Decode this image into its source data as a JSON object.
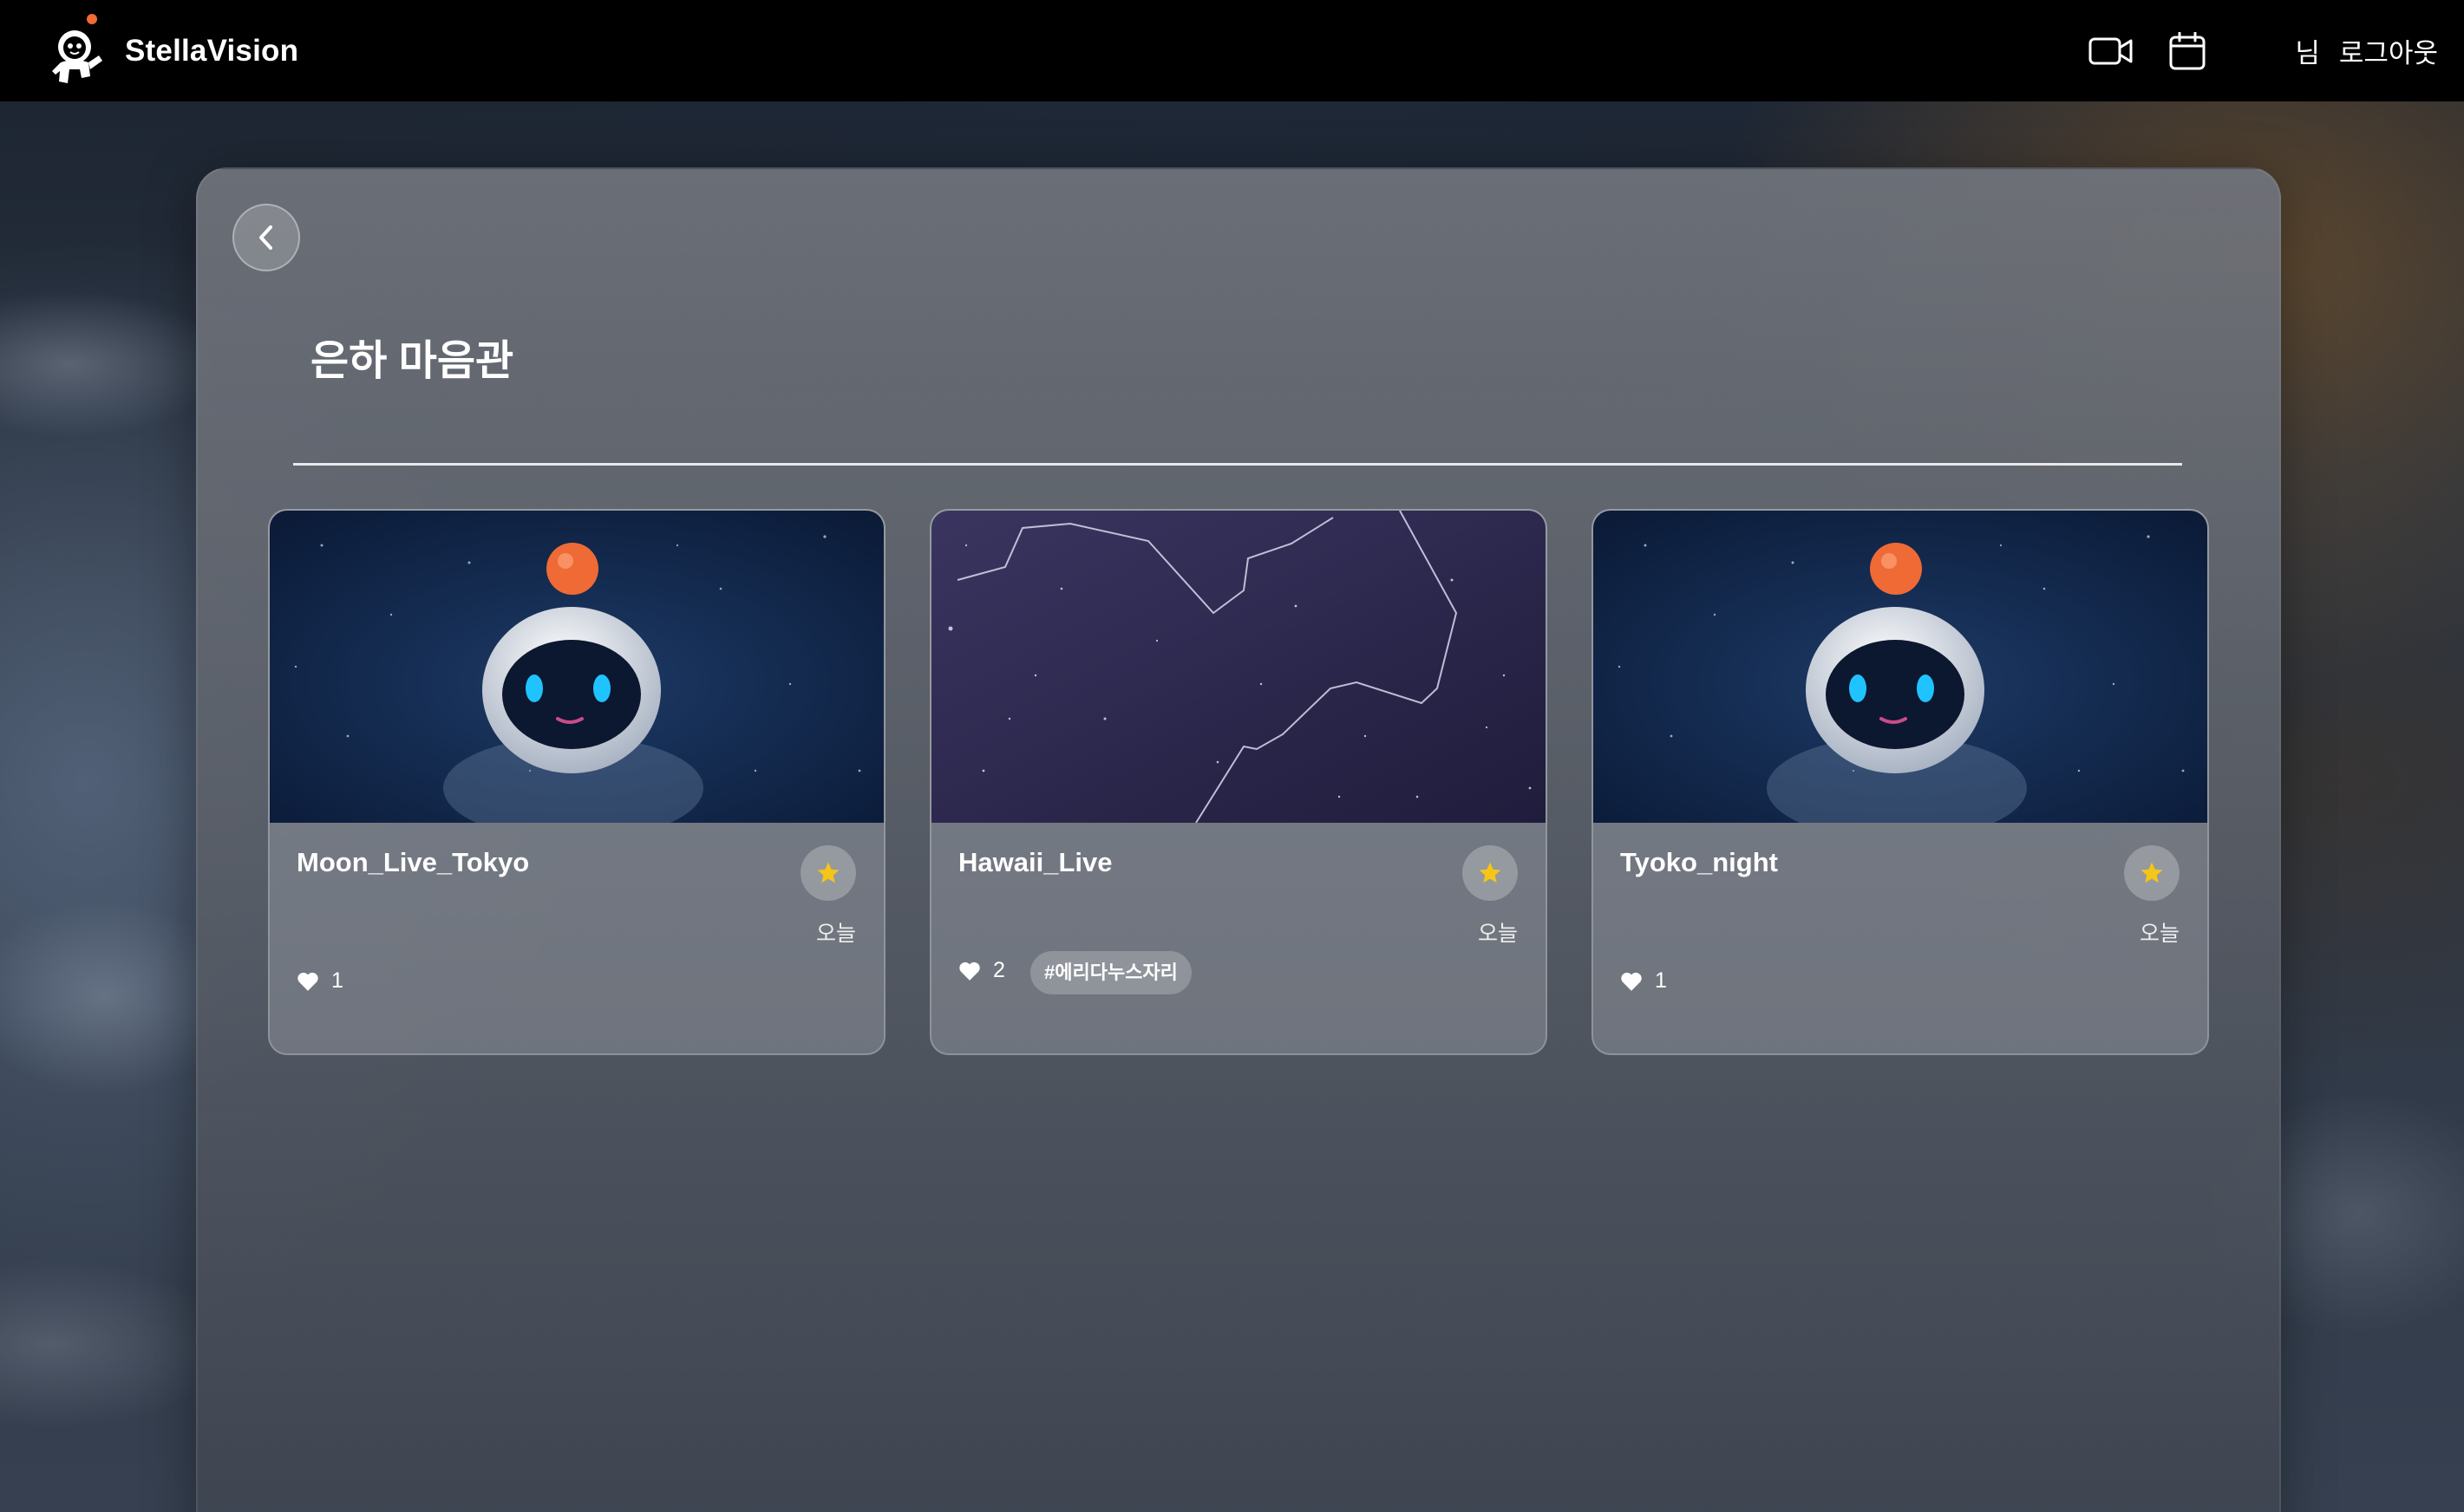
{
  "app": {
    "brand": "StellaVision"
  },
  "nav": {
    "video_icon": "video-camera-icon",
    "calendar_icon": "calendar-icon",
    "user_suffix": "님",
    "logout_label": "로그아웃"
  },
  "page": {
    "title": "은하 마음관",
    "back_icon": "chevron-left-icon"
  },
  "colors": {
    "topbar": "#000000",
    "star": "#f5c518",
    "heart": "#ffffff",
    "mascot_ball": "#ef6a35",
    "mascot_eye": "#1fc3ff"
  },
  "cards": [
    {
      "title": "Moon_Live_Tokyo",
      "date": "오늘",
      "likes": "1",
      "tag": "",
      "thumbnail": "astronaut-mascot",
      "favorited": true
    },
    {
      "title": "Hawaii_Live",
      "date": "오늘",
      "likes": "2",
      "tag": "#에리다누스자리",
      "thumbnail": "constellation-starfield",
      "favorited": true
    },
    {
      "title": "Tyoko_night",
      "date": "오늘",
      "likes": "1",
      "tag": "",
      "thumbnail": "astronaut-mascot",
      "favorited": true
    }
  ]
}
